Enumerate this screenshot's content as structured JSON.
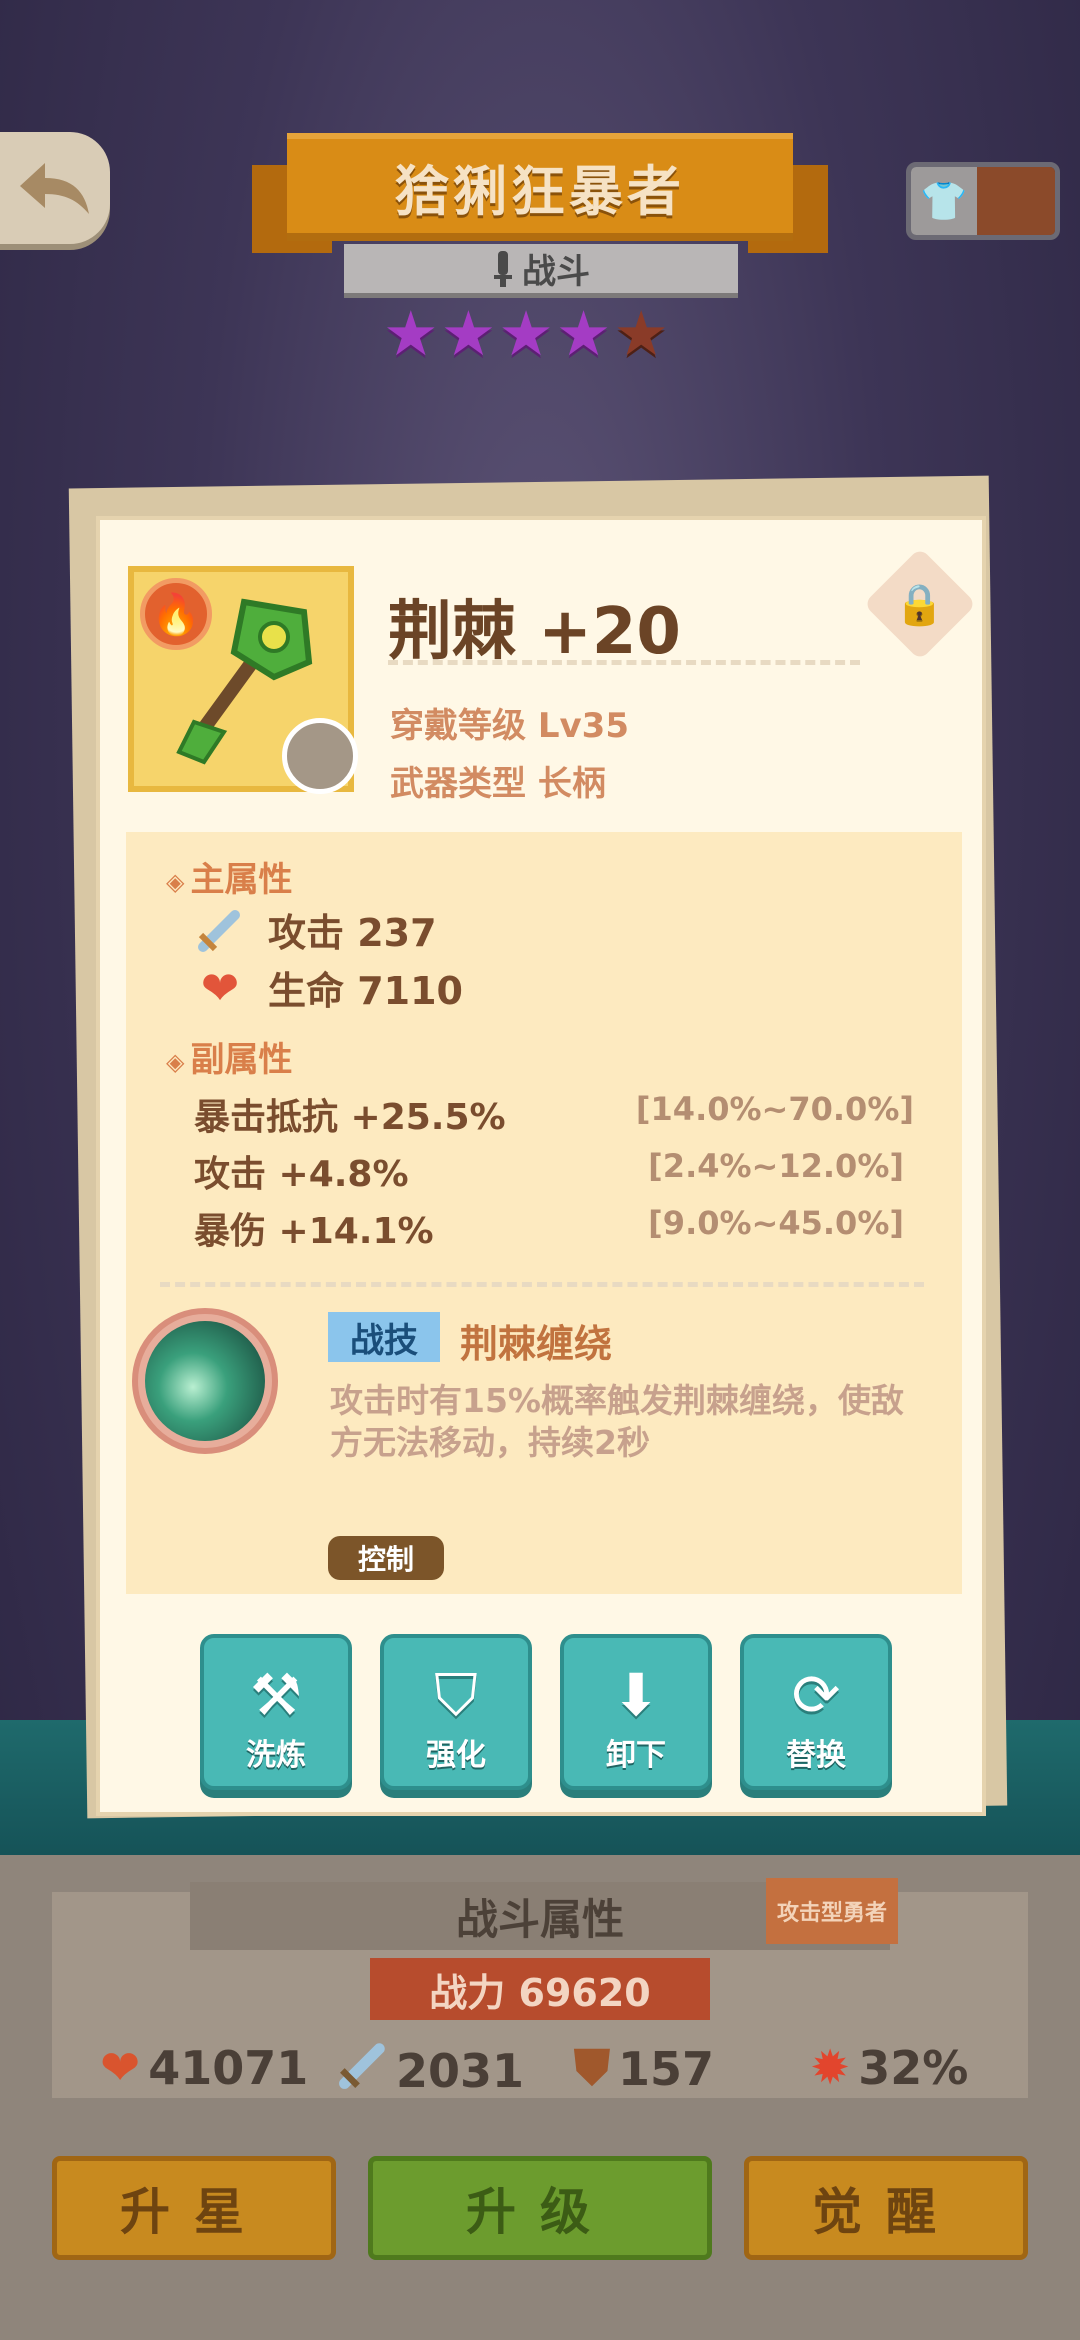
{
  "header": {
    "hero_name": "猞猁狂暴者",
    "hero_class": "战斗",
    "stars_filled": 4,
    "stars_total": 5
  },
  "item": {
    "name": "荆棘 +20",
    "wear_level": "穿戴等级 Lv35",
    "weapon_type": "武器类型 长柄"
  },
  "main_attributes": {
    "title": "主属性",
    "items": [
      {
        "icon": "sword-icon",
        "label": "攻击 237"
      },
      {
        "icon": "heart-icon",
        "label": "生命 7110"
      }
    ]
  },
  "sub_attributes": {
    "title": "副属性",
    "items": [
      {
        "label": "暴击抵抗 +25.5%",
        "range": "[14.0%~70.0%]"
      },
      {
        "label": "攻击 +4.8%",
        "range": "[2.4%~12.0%]"
      },
      {
        "label": "暴伤 +14.1%",
        "range": "[9.0%~45.0%]"
      }
    ]
  },
  "skill": {
    "tag": "战技",
    "name": "荆棘缠绕",
    "description": "攻击时有15%概率触发荆棘缠绕，使敌方无法移动，持续2秒",
    "category": "控制"
  },
  "actions": [
    {
      "label": "洗炼",
      "icon": "anvil-icon"
    },
    {
      "label": "强化",
      "icon": "upgrade-shield-icon"
    },
    {
      "label": "卸下",
      "icon": "unequip-arrow-icon"
    },
    {
      "label": "替换",
      "icon": "swap-icon"
    }
  ],
  "battle_stats": {
    "title": "战斗属性",
    "role": "攻击型勇者",
    "power": "战力 69620",
    "hp": "41071",
    "attack": "2031",
    "defense": "157",
    "crit": "32%"
  },
  "bottom_buttons": {
    "star_up": "升星",
    "level_up": "升级",
    "awaken": "觉醒"
  },
  "colors": {
    "accent_teal": "#49b9b5",
    "card_bg": "#fff8e6",
    "title_orange": "#d98c16"
  }
}
